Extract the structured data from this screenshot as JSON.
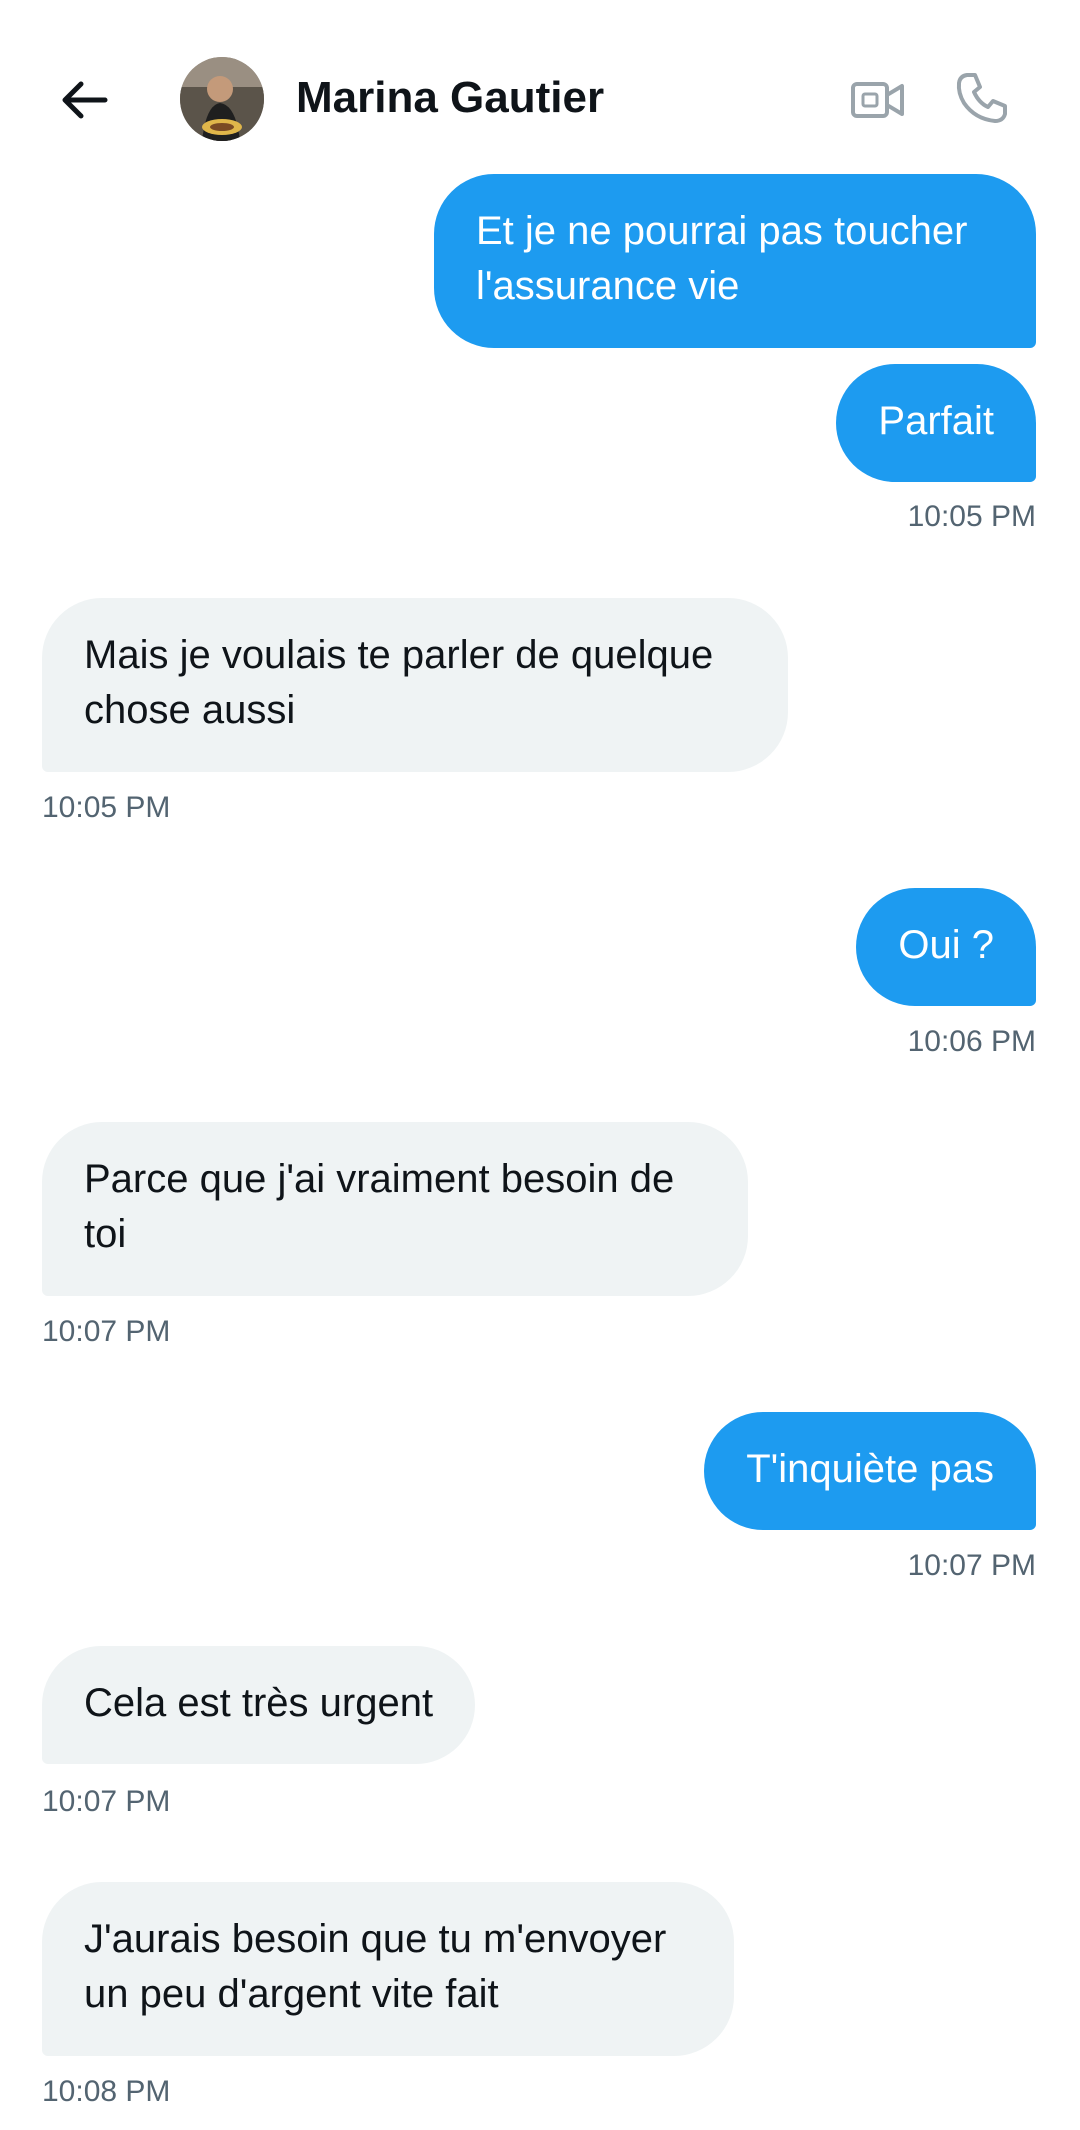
{
  "header": {
    "contact_name": "Marina Gautier",
    "back_icon": "arrow-left-icon",
    "video_icon": "video-camera-icon",
    "call_icon": "phone-icon"
  },
  "colors": {
    "outgoing_bubble": "#1d9bf0",
    "incoming_bubble": "#eff3f4",
    "timestamp": "#536471",
    "text": "#0f1419"
  },
  "messages": [
    {
      "direction": "out",
      "text": "Et je ne pourrai pas toucher l'assurance vie",
      "time": ""
    },
    {
      "direction": "out",
      "text": "Parfait",
      "time": "10:05 PM"
    },
    {
      "direction": "in",
      "text": "Mais je voulais te parler de quelque chose aussi",
      "time": "10:05 PM"
    },
    {
      "direction": "out",
      "text": "Oui ?",
      "time": "10:06 PM"
    },
    {
      "direction": "in",
      "text": "Parce que j'ai vraiment besoin de toi",
      "time": "10:07 PM"
    },
    {
      "direction": "out",
      "text": "T'inquiète pas",
      "time": "10:07 PM"
    },
    {
      "direction": "in",
      "text": "Cela est très urgent",
      "time": "10:07 PM"
    },
    {
      "direction": "in",
      "text": "J'aurais besoin que tu m'envoyer un peu d'argent vite fait",
      "time": "10:08 PM"
    }
  ]
}
